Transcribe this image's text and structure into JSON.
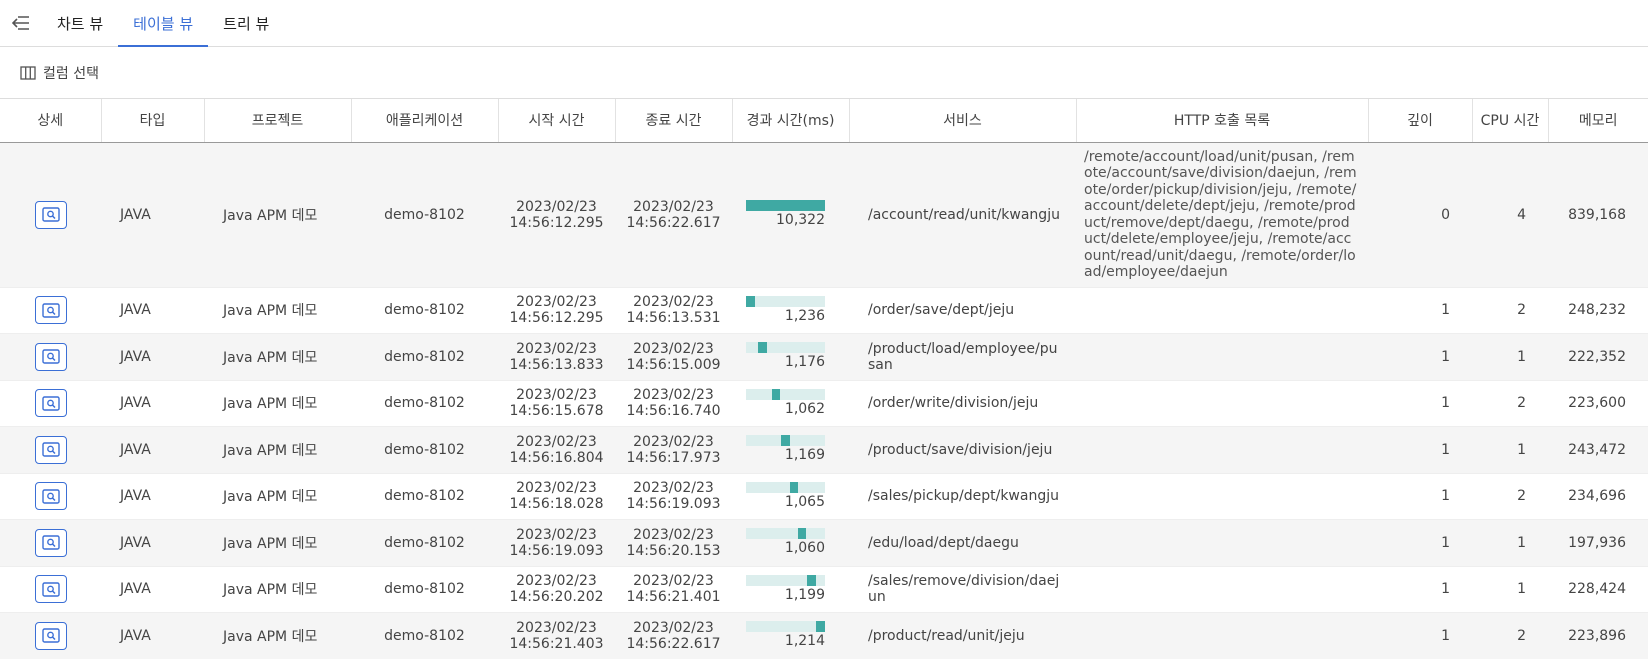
{
  "tabs": [
    {
      "label": "차트 뷰",
      "active": false
    },
    {
      "label": "테이블 뷰",
      "active": true
    },
    {
      "label": "트리 뷰",
      "active": false
    }
  ],
  "toolbar": {
    "column_select_label": "컬럼 선택"
  },
  "colors": {
    "accent": "#3b6fd6",
    "bar_fill": "#3fa9a3",
    "bar_bg": "#dceeed"
  },
  "table": {
    "headers": [
      "상세",
      "타입",
      "프로젝트",
      "애플리케이션",
      "시작 시간",
      "종료 시간",
      "경과 시간(ms)",
      "서비스",
      "HTTP 호출 목록",
      "깊이",
      "CPU 시간",
      "메모리"
    ],
    "rows": [
      {
        "type": "JAVA",
        "project": "Java APM 데모",
        "app": "demo-8102",
        "start_date": "2023/02/23",
        "start_time": "14:56:12.295",
        "end_date": "2023/02/23",
        "end_time": "14:56:22.617",
        "elapsed": "10,322",
        "bar_start": 0.0,
        "bar_end": 1.0,
        "service": "/account/read/unit/kwangju",
        "http": "/remote/account/load/unit/pusan, /remote/account/save/division/daejun, /remote/order/pickup/division/jeju, /remote/account/delete/dept/jeju, /remote/product/remove/dept/daegu, /remote/product/delete/employee/jeju, /remote/account/read/unit/daegu, /remote/order/load/employee/daejun",
        "depth": "0",
        "cpu": "4",
        "memory": "839,168"
      },
      {
        "type": "JAVA",
        "project": "Java APM 데모",
        "app": "demo-8102",
        "start_date": "2023/02/23",
        "start_time": "14:56:12.295",
        "end_date": "2023/02/23",
        "end_time": "14:56:13.531",
        "elapsed": "1,236",
        "bar_start": 0.0,
        "bar_end": 0.12,
        "service": "/order/save/dept/jeju",
        "http": "",
        "depth": "1",
        "cpu": "2",
        "memory": "248,232"
      },
      {
        "type": "JAVA",
        "project": "Java APM 데모",
        "app": "demo-8102",
        "start_date": "2023/02/23",
        "start_time": "14:56:13.833",
        "end_date": "2023/02/23",
        "end_time": "14:56:15.009",
        "elapsed": "1,176",
        "bar_start": 0.149,
        "bar_end": 0.263,
        "service": "/product/load/employee/pusan",
        "http": "",
        "depth": "1",
        "cpu": "1",
        "memory": "222,352"
      },
      {
        "type": "JAVA",
        "project": "Java APM 데모",
        "app": "demo-8102",
        "start_date": "2023/02/23",
        "start_time": "14:56:15.678",
        "end_date": "2023/02/23",
        "end_time": "14:56:16.740",
        "elapsed": "1,062",
        "bar_start": 0.328,
        "bar_end": 0.431,
        "service": "/order/write/division/jeju",
        "http": "",
        "depth": "1",
        "cpu": "2",
        "memory": "223,600"
      },
      {
        "type": "JAVA",
        "project": "Java APM 데모",
        "app": "demo-8102",
        "start_date": "2023/02/23",
        "start_time": "14:56:16.804",
        "end_date": "2023/02/23",
        "end_time": "14:56:17.973",
        "elapsed": "1,169",
        "bar_start": 0.437,
        "bar_end": 0.551,
        "service": "/product/save/division/jeju",
        "http": "",
        "depth": "1",
        "cpu": "1",
        "memory": "243,472"
      },
      {
        "type": "JAVA",
        "project": "Java APM 데모",
        "app": "demo-8102",
        "start_date": "2023/02/23",
        "start_time": "14:56:18.028",
        "end_date": "2023/02/23",
        "end_time": "14:56:19.093",
        "elapsed": "1,065",
        "bar_start": 0.556,
        "bar_end": 0.659,
        "service": "/sales/pickup/dept/kwangju",
        "http": "",
        "depth": "1",
        "cpu": "2",
        "memory": "234,696"
      },
      {
        "type": "JAVA",
        "project": "Java APM 데모",
        "app": "demo-8102",
        "start_date": "2023/02/23",
        "start_time": "14:56:19.093",
        "end_date": "2023/02/23",
        "end_time": "14:56:20.153",
        "elapsed": "1,060",
        "bar_start": 0.659,
        "bar_end": 0.762,
        "service": "/edu/load/dept/daegu",
        "http": "",
        "depth": "1",
        "cpu": "1",
        "memory": "197,936"
      },
      {
        "type": "JAVA",
        "project": "Java APM 데모",
        "app": "demo-8102",
        "start_date": "2023/02/23",
        "start_time": "14:56:20.202",
        "end_date": "2023/02/23",
        "end_time": "14:56:21.401",
        "elapsed": "1,199",
        "bar_start": 0.766,
        "bar_end": 0.883,
        "service": "/sales/remove/division/daejun",
        "http": "",
        "depth": "1",
        "cpu": "1",
        "memory": "228,424"
      },
      {
        "type": "JAVA",
        "project": "Java APM 데모",
        "app": "demo-8102",
        "start_date": "2023/02/23",
        "start_time": "14:56:21.403",
        "end_date": "2023/02/23",
        "end_time": "14:56:22.617",
        "elapsed": "1,214",
        "bar_start": 0.883,
        "bar_end": 1.0,
        "service": "/product/read/unit/jeju",
        "http": "",
        "depth": "1",
        "cpu": "2",
        "memory": "223,896"
      }
    ]
  }
}
